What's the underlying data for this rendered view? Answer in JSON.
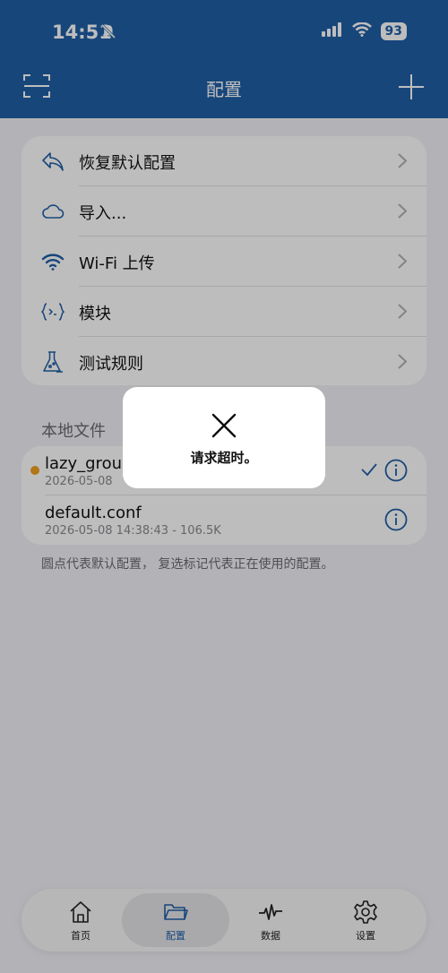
{
  "status_bar": {
    "time": "14:51",
    "battery": "93"
  },
  "nav": {
    "title": "配置"
  },
  "menu": [
    {
      "label": "恢复默认配置",
      "icon": "undo-icon"
    },
    {
      "label": "导入...",
      "icon": "cloud-icon"
    },
    {
      "label": "Wi-Fi 上传",
      "icon": "wifi-icon"
    },
    {
      "label": "模块",
      "icon": "module-braces-icon"
    },
    {
      "label": "测试规则",
      "icon": "flask-icon"
    }
  ],
  "local_files": {
    "section_label": "本地文件",
    "files": [
      {
        "name": "lazy_group",
        "meta": "2026-05-08",
        "is_default": true,
        "in_use": true
      },
      {
        "name": "default.conf",
        "meta": "2026-05-08 14:38:43 - 106.5K",
        "is_default": false,
        "in_use": false
      }
    ],
    "footnote": "圆点代表默认配置， 复选标记代表正在使用的配置。"
  },
  "tabs": [
    {
      "label": "首页",
      "icon": "home-icon"
    },
    {
      "label": "配置",
      "icon": "folder-icon",
      "active": true
    },
    {
      "label": "数据",
      "icon": "pulse-icon"
    },
    {
      "label": "设置",
      "icon": "gear-icon"
    }
  ],
  "toast": {
    "message": "请求超时。"
  },
  "colors": {
    "accent": "#1f5fa6",
    "default_dot": "#f0a020"
  }
}
